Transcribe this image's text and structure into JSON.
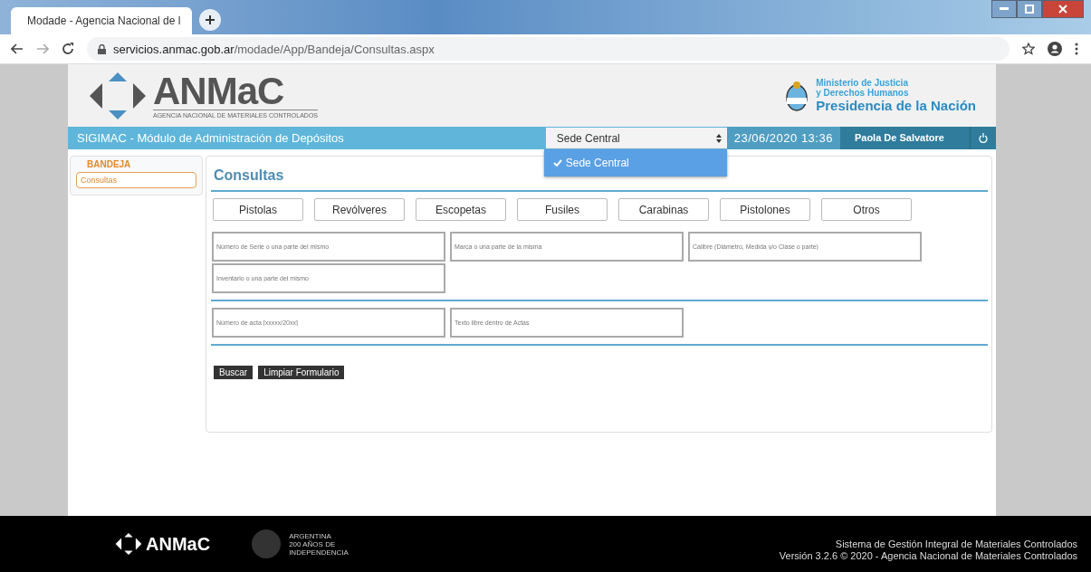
{
  "browser": {
    "tab_title": "Modade - Agencia Nacional de l",
    "url_host": "servicios.anmac.gob.ar",
    "url_path": "/modade/App/Bandeja/Consultas.aspx"
  },
  "header": {
    "logo_text": "ANMaC",
    "logo_subtitle": "AGENCIA NACIONAL DE MATERIALES CONTROLADOS",
    "ministry_line1": "Ministerio de Justicia",
    "ministry_line2": "y Derechos Humanos",
    "presidency": "Presidencia de la Nación"
  },
  "top_bar": {
    "title": "SIGIMAC - Módulo de Administración de Depósitos",
    "site_select": "Sede Central",
    "site_options": [
      {
        "label": "Sede Central",
        "selected": true
      }
    ],
    "datetime": "23/06/2020 13:36",
    "user": "Paola De Salvatore"
  },
  "sidebar": {
    "heading": "BANDEJA",
    "items": [
      {
        "label": "Consultas",
        "selected": true
      }
    ]
  },
  "main": {
    "title": "Consultas",
    "categories": [
      "Pistolas",
      "Revólveres",
      "Escopetas",
      "Fusiles",
      "Carabinas",
      "Pistolones",
      "Otros"
    ],
    "weapon_fields": [
      {
        "placeholder": "Número de Serie o una parte del mismo"
      },
      {
        "placeholder": "Marca o una parte de la misma"
      },
      {
        "placeholder": "Calibre (Diámetro, Medida y/o Clase o parte)"
      },
      {
        "placeholder": "Inventario o una parte del mismo"
      }
    ],
    "act_fields": [
      {
        "placeholder": "Número de acta [xxxxx/20xx]"
      },
      {
        "placeholder": "Texto libre dentro de Actas"
      }
    ],
    "buttons": [
      "Buscar",
      "Limpiar Formulario"
    ]
  },
  "footer": {
    "logo_text": "ANMaC",
    "bicentennial": [
      "ARGENTINA",
      "200 AÑOS DE",
      "INDEPENDENCIA"
    ],
    "system_name": "Sistema de Gestión Integral de Materiales Controlados",
    "version": "Versión 3.2.6 © 2020 - Agencia Nacional de Materiales Controlados"
  }
}
